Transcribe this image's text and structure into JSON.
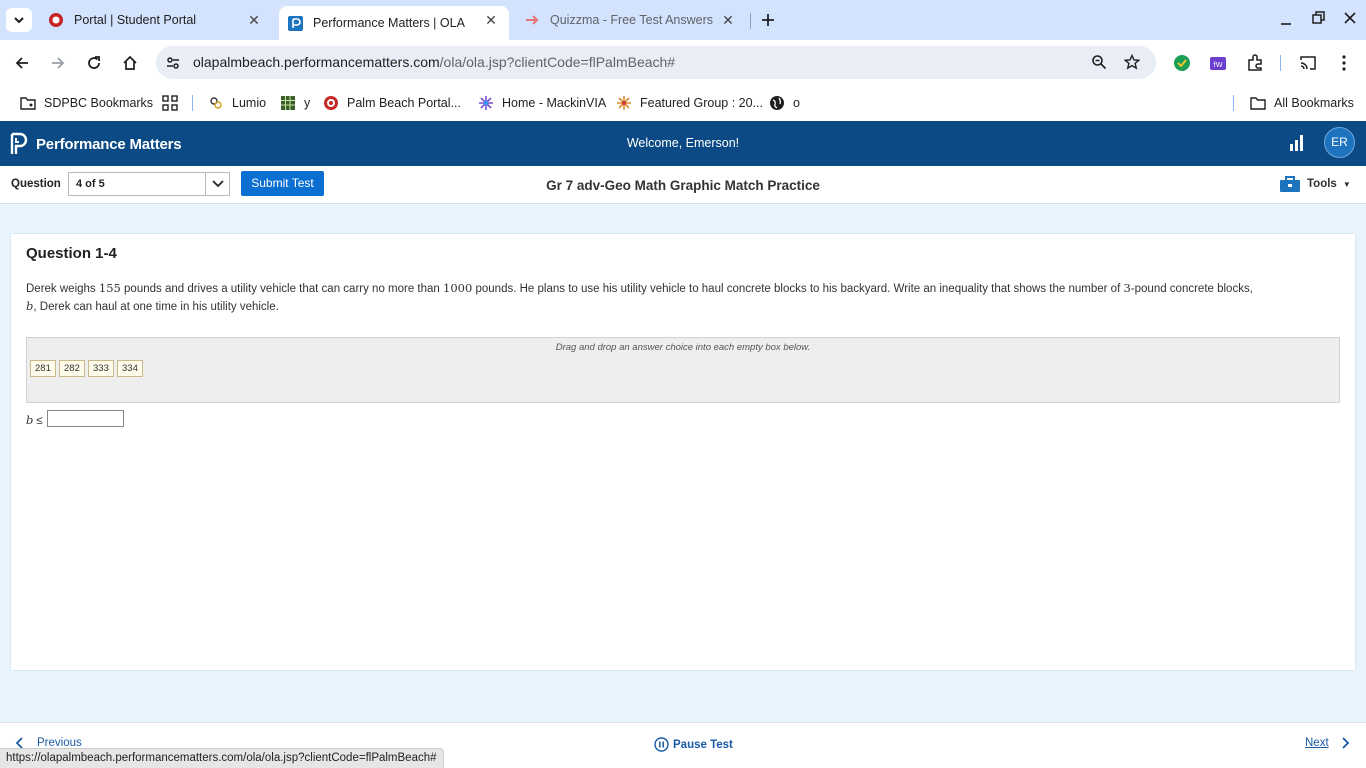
{
  "browser": {
    "tabs": [
      {
        "title": "Portal | Student Portal",
        "active": false
      },
      {
        "title": "Performance Matters | OLA",
        "active": true
      },
      {
        "title": "Quizzma - Free Test Answers W",
        "active": false
      }
    ],
    "url_host": "olapalmbeach.performancematters.com",
    "url_path": "/ola/ola.jsp?clientCode=flPalmBeach#",
    "bookmarks": [
      "SDPBC Bookmarks",
      "Lumio",
      "y",
      "Palm Beach Portal...",
      "Home - MackinVIA",
      "Featured Group : 20...",
      "o"
    ],
    "all_bookmarks": "All Bookmarks"
  },
  "app": {
    "logo_text": "Performance Matters",
    "welcome": "Welcome, Emerson!",
    "avatar_initials": "ER"
  },
  "question_bar": {
    "label": "Question",
    "selected": "4 of 5",
    "submit_label": "Submit Test",
    "test_title": "Gr 7 adv-Geo Math Graphic Match Practice",
    "tools_label": "Tools"
  },
  "question": {
    "heading": "Question 1-4",
    "text_1": "Derek weighs ",
    "num_1": "155",
    "text_2": " pounds and drives a utility vehicle that can carry no more than ",
    "num_2": "1000",
    "text_3": " pounds. He plans to use his utility vehicle to haul concrete blocks to his backyard. Write an inequality that shows the number of ",
    "num_3": "3",
    "text_4": "-pound concrete blocks,",
    "var_b": "b",
    "text_5": ", Derek can haul at one time in his utility vehicle.",
    "drag_hint": "Drag and drop an answer choice into each empty box below.",
    "choices": [
      "281",
      "282",
      "333",
      "334"
    ],
    "answer_var": "b",
    "answer_op": "≤"
  },
  "footer": {
    "previous": "Previous",
    "pause": "Pause Test",
    "next": "Next"
  },
  "status_url": "https://olapalmbeach.performancematters.com/ola/ola.jsp?clientCode=flPalmBeach#",
  "colors": {
    "tabstrip": "#d3e3fd",
    "app_header": "#0b4a84",
    "submit": "#0a6fd0",
    "content_bg": "#e8f4fc"
  }
}
